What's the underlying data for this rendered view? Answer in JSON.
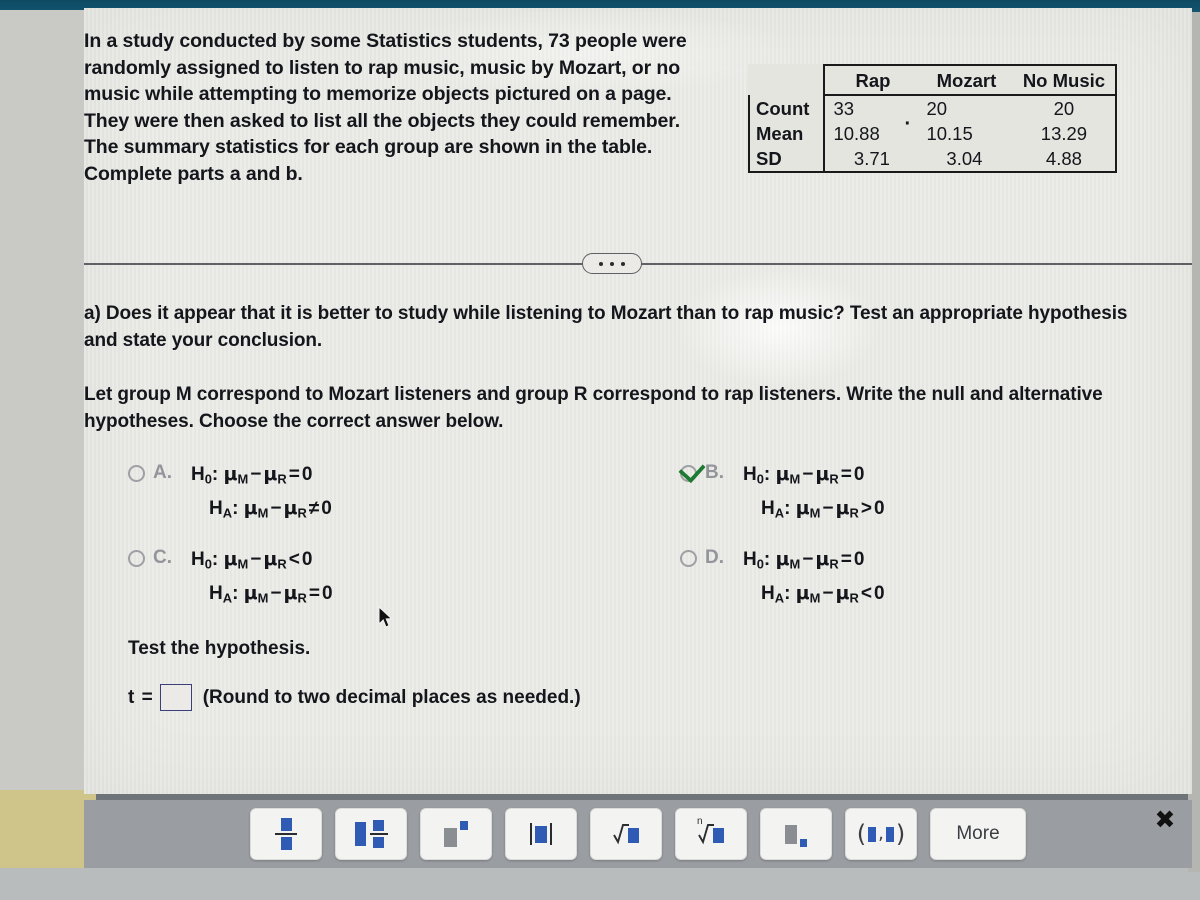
{
  "problem": {
    "stem_lines": [
      "In a study conducted by some Statistics students, 73 people were",
      "randomly assigned to listen to rap music, music by Mozart, or no",
      "music while attempting to memorize objects pictured on a page.",
      "They were then asked to list all the objects they could remember.",
      "The summary statistics for each group are shown in the table.",
      "Complete parts a and b."
    ]
  },
  "summary_table": {
    "corner": "",
    "columns": [
      "Rap",
      "Mozart",
      "No Music"
    ],
    "rows": [
      {
        "label": "Count",
        "values": [
          "33",
          "20",
          "20"
        ]
      },
      {
        "label": "Mean",
        "values": [
          "10.88",
          "10.15",
          "13.29"
        ]
      },
      {
        "label": "SD",
        "values": [
          "3.71",
          "3.04",
          "4.88"
        ]
      }
    ]
  },
  "divider": {
    "ellipsis_label": "..."
  },
  "part_a": {
    "question_line1": "a) Does it appear that it is better to study while listening to Mozart than to rap music? Test an appropriate hypothesis",
    "question_line2": "and state your conclusion.",
    "instruction_line1": "Let group M correspond to Mozart listeners and group R correspond to rap listeners. Write the null and alternative",
    "instruction_line2": "hypotheses. Choose the correct answer below."
  },
  "choices": [
    {
      "letter": "A.",
      "selected": false,
      "null_hyp": {
        "prefix": "H",
        "sub": "0",
        "colon": ":",
        "mu1": "μ",
        "sub1": "M",
        "minus": "−",
        "mu2": "μ",
        "sub2": "R",
        "rel": "=",
        "value": "0"
      },
      "alt_hyp": {
        "prefix": "H",
        "sub": "A",
        "colon": ":",
        "mu1": "μ",
        "sub1": "M",
        "minus": "−",
        "mu2": "μ",
        "sub2": "R",
        "rel": "≠",
        "value": "0"
      }
    },
    {
      "letter": "B.",
      "selected": true,
      "null_hyp": {
        "prefix": "H",
        "sub": "0",
        "colon": ":",
        "mu1": "μ",
        "sub1": "M",
        "minus": "−",
        "mu2": "μ",
        "sub2": "R",
        "rel": "=",
        "value": "0"
      },
      "alt_hyp": {
        "prefix": "H",
        "sub": "A",
        "colon": ":",
        "mu1": "μ",
        "sub1": "M",
        "minus": "−",
        "mu2": "μ",
        "sub2": "R",
        "rel": ">",
        "value": "0"
      }
    },
    {
      "letter": "C.",
      "selected": false,
      "null_hyp": {
        "prefix": "H",
        "sub": "0",
        "colon": ":",
        "mu1": "μ",
        "sub1": "M",
        "minus": "−",
        "mu2": "μ",
        "sub2": "R",
        "rel": "<",
        "value": "0"
      },
      "alt_hyp": {
        "prefix": "H",
        "sub": "A",
        "colon": ":",
        "mu1": "μ",
        "sub1": "M",
        "minus": "−",
        "mu2": "μ",
        "sub2": "R",
        "rel": "=",
        "value": "0"
      }
    },
    {
      "letter": "D.",
      "selected": false,
      "null_hyp": {
        "prefix": "H",
        "sub": "0",
        "colon": ":",
        "mu1": "μ",
        "sub1": "M",
        "minus": "−",
        "mu2": "μ",
        "sub2": "R",
        "rel": "=",
        "value": "0"
      },
      "alt_hyp": {
        "prefix": "H",
        "sub": "A",
        "colon": ":",
        "mu1": "μ",
        "sub1": "M",
        "minus": "−",
        "mu2": "μ",
        "sub2": "R",
        "rel": "<",
        "value": "0"
      }
    }
  ],
  "test_section": {
    "heading": "Test the hypothesis.",
    "t_label": "t =",
    "t_value": "",
    "rounding_note": "(Round to two decimal places as needed.)"
  },
  "toolbar": {
    "buttons": [
      {
        "name": "fraction-button",
        "label": ""
      },
      {
        "name": "mixed-number-button",
        "label": ""
      },
      {
        "name": "exponent-button",
        "label": ""
      },
      {
        "name": "absolute-value-button",
        "label": ""
      },
      {
        "name": "square-root-button",
        "label": ""
      },
      {
        "name": "nth-root-button",
        "label": ""
      },
      {
        "name": "subscript-button",
        "label": ""
      },
      {
        "name": "ordered-pair-button",
        "label": ""
      },
      {
        "name": "more-button",
        "label": "More"
      }
    ],
    "more_label": "More",
    "nth_root_index": "n"
  },
  "close_button": {
    "glyph": "✖"
  },
  "colors": {
    "selected_check": "#1d7a33",
    "toolbar_glyph": "#2f5bb5",
    "input_border": "#3b3f7a",
    "top_band": "#11506b"
  }
}
